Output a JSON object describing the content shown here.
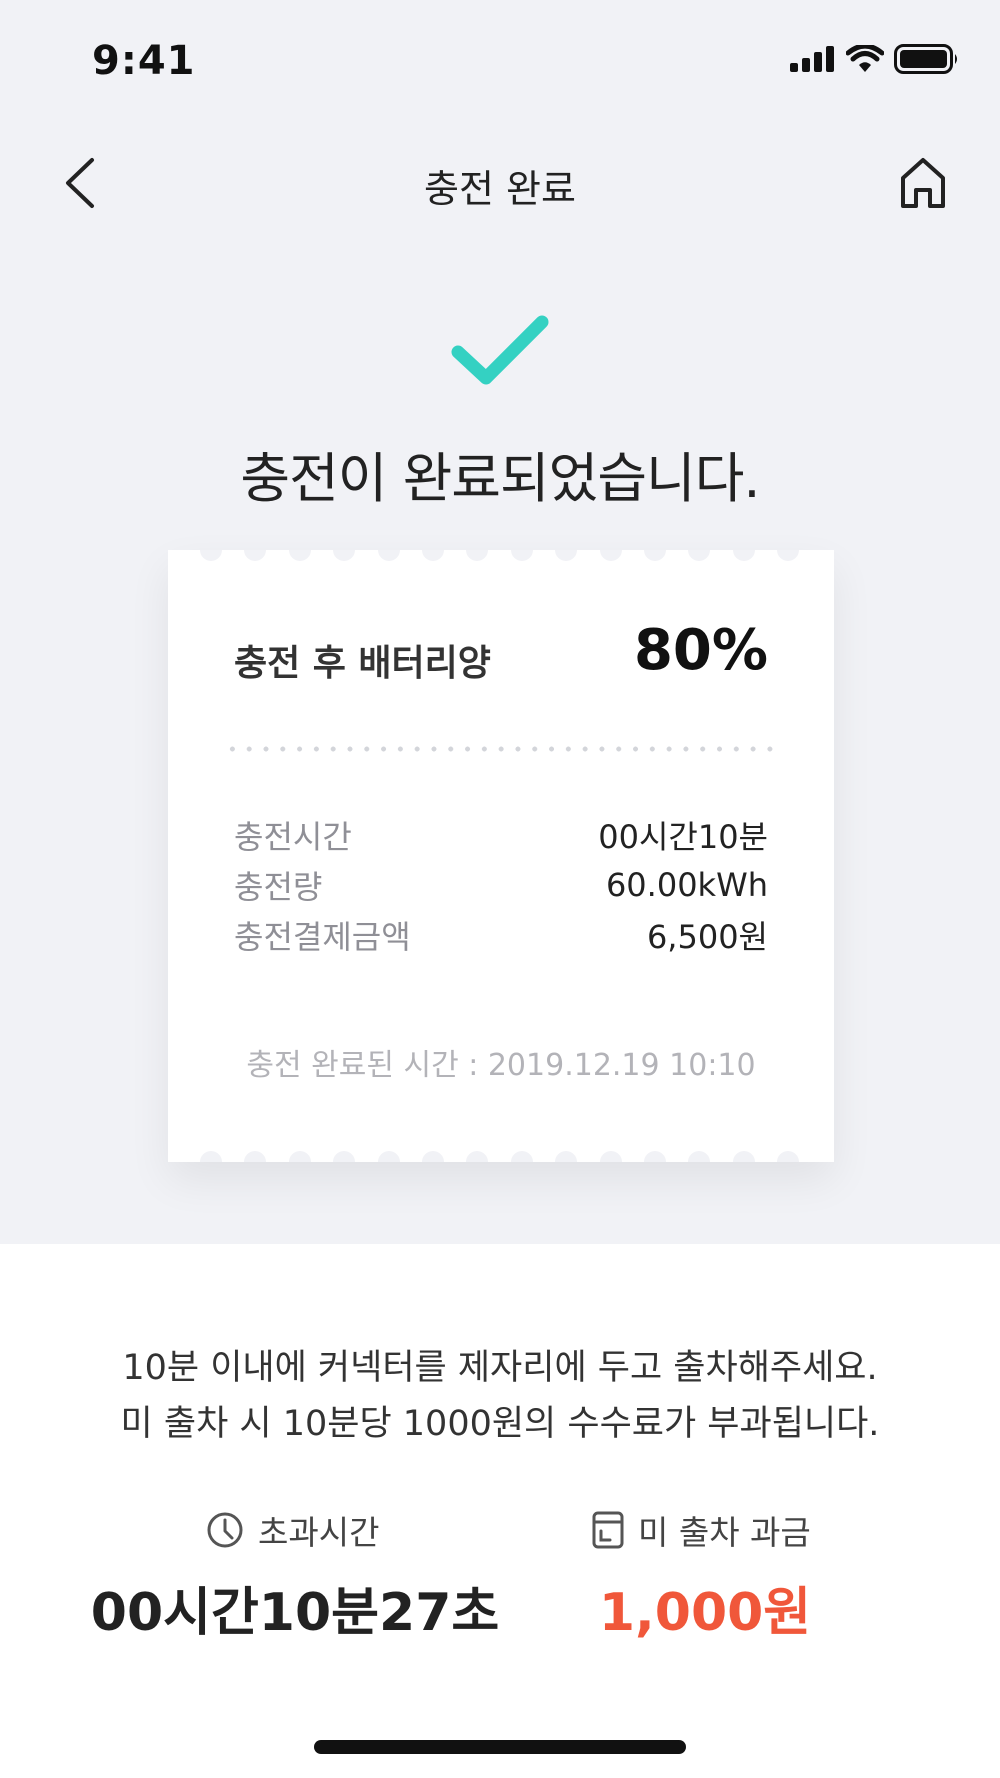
{
  "status_bar": {
    "time": "9:41"
  },
  "nav": {
    "title": "충전 완료"
  },
  "headline": "충전이 완료되었습니다.",
  "receipt": {
    "battery_label": "충전 후 배터리양",
    "battery_value": "80%",
    "details": [
      {
        "label": "충전시간",
        "value": "00시간10분"
      },
      {
        "label": "충전량",
        "value": "60.00kWh"
      },
      {
        "label": "충전결제금액",
        "value": "6,500원"
      }
    ],
    "completed_time": "충전 완료된 시간 : 2019.12.19 10:10"
  },
  "notice": {
    "line1": "10분 이내에 커넥터를 제자리에 두고 출차해주세요.",
    "line2": "미 출차 시 10분당 1000원의 수수료가 부과됩니다."
  },
  "overtime": {
    "label": "초과시간",
    "value": "00시간10분27초",
    "icon": "clock-icon"
  },
  "fee": {
    "label": "미 출차 과금",
    "value": "1,000원",
    "icon": "card-icon"
  },
  "colors": {
    "accent": "#34d1c2",
    "fee": "#f0573a",
    "background": "#f1f2f6"
  }
}
